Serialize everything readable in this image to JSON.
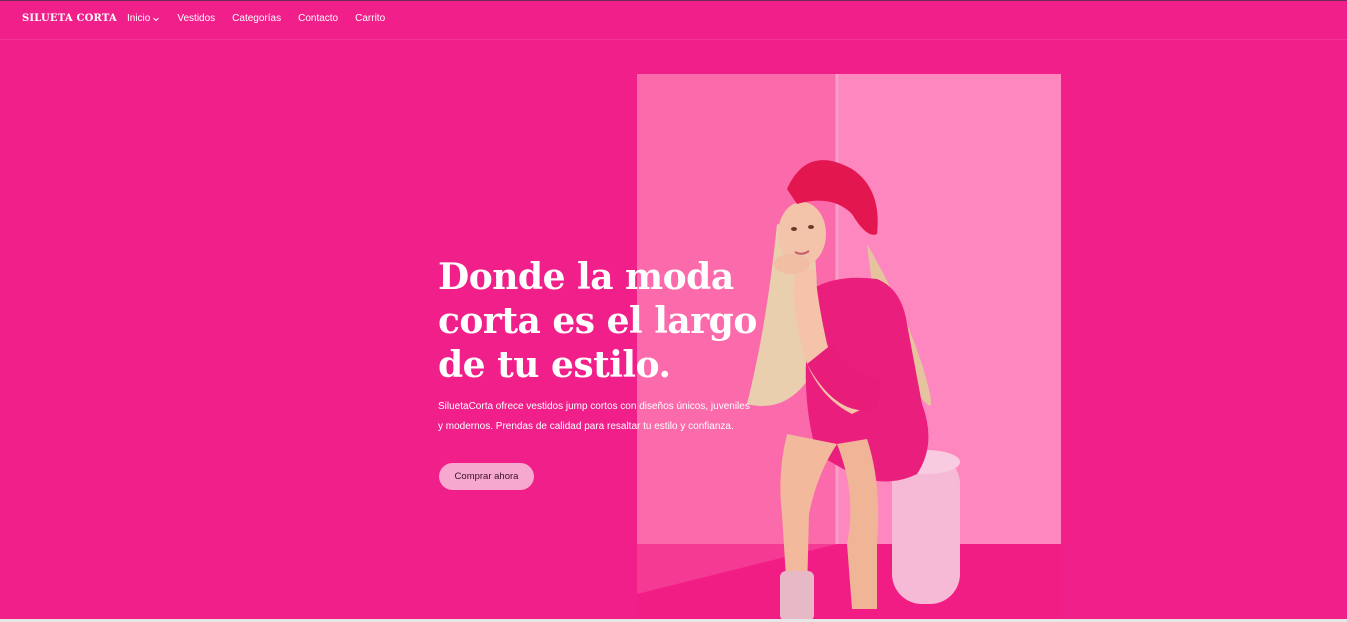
{
  "header": {
    "brand": "SILUETA CORTA",
    "nav": [
      {
        "label": "Inicio",
        "has_dropdown": true
      },
      {
        "label": "Vestidos"
      },
      {
        "label": "Categorías"
      },
      {
        "label": "Contacto"
      },
      {
        "label": "Carrito"
      }
    ]
  },
  "hero": {
    "title_line1": "Donde la moda",
    "title_line2": "corta es el largo",
    "title_line3": "de tu estilo.",
    "subtitle_line1": "SiluetaCorta ofrece vestidos jump cortos con diseños únicos, juveniles",
    "subtitle_line2": "y modernos. Prendas de calidad para resaltar tu estilo y confianza.",
    "cta_label": "Comprar ahora"
  },
  "colors": {
    "background": "#f01f8a",
    "button": "#f6a8cf",
    "text": "#ffffff"
  }
}
